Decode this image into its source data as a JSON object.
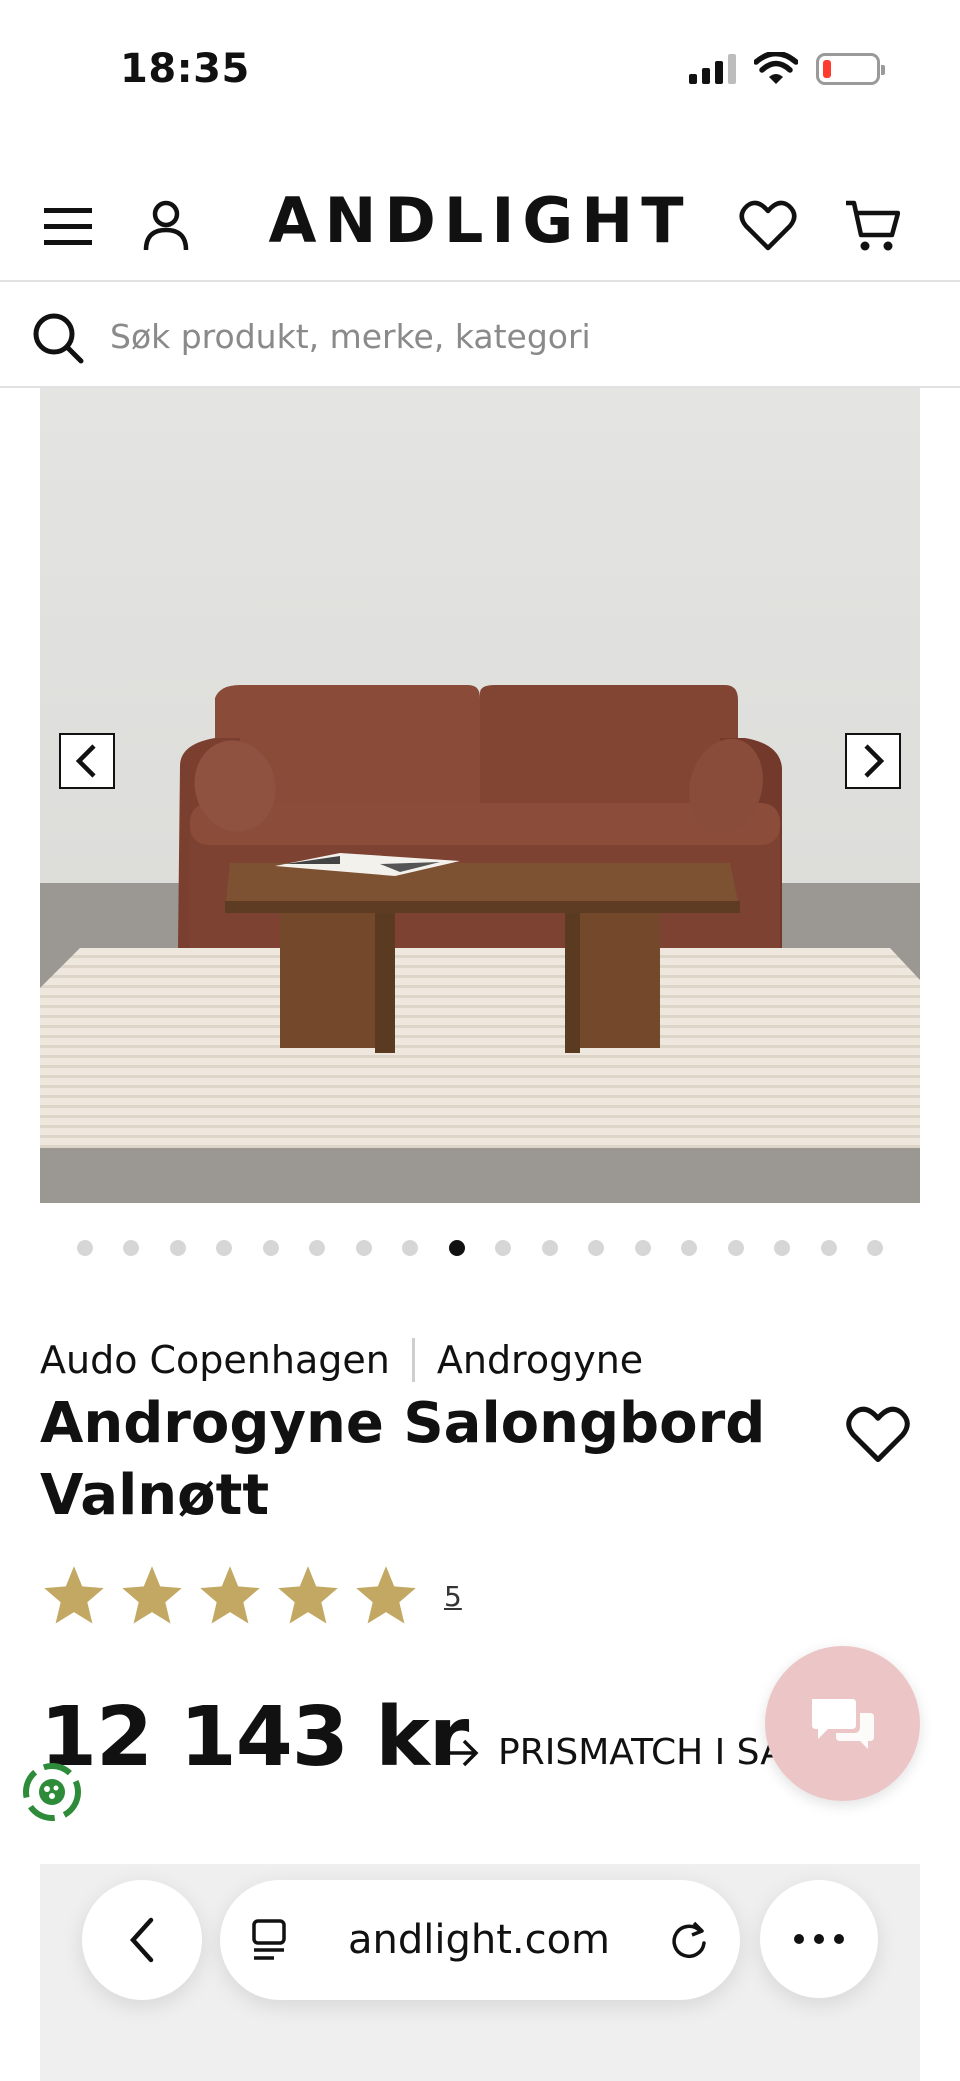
{
  "status_bar": {
    "time": "18:35"
  },
  "header": {
    "logo": "ANDLIGHT",
    "icons": [
      "menu-icon",
      "account-icon",
      "heart-icon",
      "cart-icon"
    ]
  },
  "search": {
    "placeholder": "Søk produkt, merke, kategori"
  },
  "gallery": {
    "dot_count": 18,
    "active_dot_index": 8
  },
  "product": {
    "brand": "Audo Copenhagen",
    "collection": "Androgyne",
    "title": "Androgyne Salongbord Valnøtt",
    "rating_stars": 5,
    "review_count": "5",
    "price": "12 143 kr",
    "prismatch_label": "PRISMATCH I SALG"
  },
  "colors": {
    "star": "#c2a862",
    "chat_fab": "#ecc6c6",
    "eco_badge": "#2e8b3a"
  },
  "browser": {
    "url": "andlight.com"
  }
}
